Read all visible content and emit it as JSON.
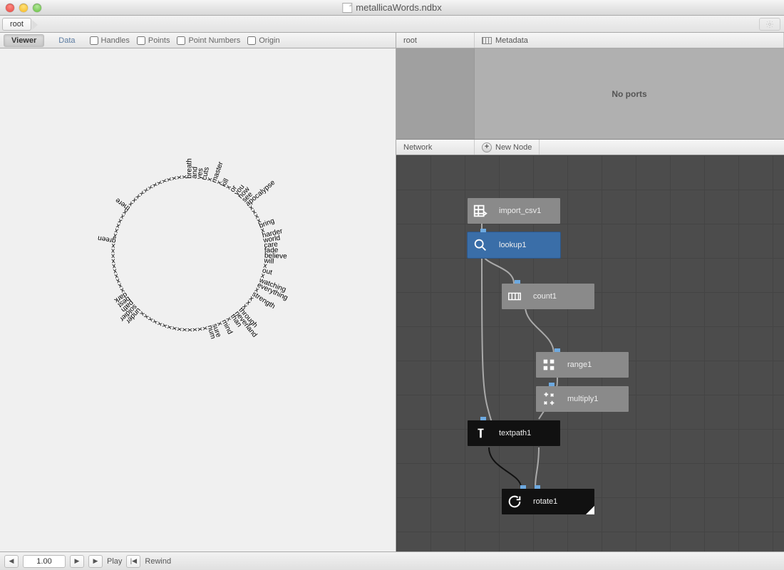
{
  "window": {
    "title": "metallicaWords.ndbx",
    "breadcrumb": "root"
  },
  "left": {
    "tabs": {
      "viewer": "Viewer",
      "data": "Data"
    },
    "checks": {
      "handles": "Handles",
      "points": "Points",
      "pointnums": "Point Numbers",
      "origin": "Origin"
    }
  },
  "props": {
    "root_label": "root",
    "metadata_label": "Metadata",
    "noports": "No ports"
  },
  "network": {
    "header": "Network",
    "newnode": "New Node",
    "nodes": {
      "import": "import_csv1",
      "lookup": "lookup1",
      "count": "count1",
      "range": "range1",
      "multiply": "multiply1",
      "textpath": "textpath1",
      "rotate": "rotate1"
    }
  },
  "footer": {
    "frame": "1.00",
    "play": "Play",
    "rewind": "Rewind"
  },
  "words": [
    "breath",
    "and",
    "yes",
    "cuts",
    "x",
    "master",
    "x",
    "kill",
    "x",
    "or",
    "you",
    "now",
    "see",
    "apocalypse",
    "x",
    "x",
    "x",
    "x",
    "bring",
    "x",
    "harder",
    "world",
    "care",
    "fade",
    "believe",
    "will",
    "x",
    "out",
    "x",
    "watching",
    "everything",
    "x",
    "strength",
    "x",
    "x",
    "x",
    "through",
    "neverland",
    "than",
    "x",
    "mind",
    "x",
    "sure",
    "num",
    "x",
    "x",
    "x",
    "x",
    "x",
    "x",
    "x",
    "x",
    "x",
    "x",
    "x",
    "x",
    "x",
    "x",
    "under",
    "soldier",
    "path",
    "best",
    "dark",
    "x",
    "x",
    "x",
    "x",
    "x",
    "x",
    "x",
    "x",
    "x",
    "x",
    "green",
    "x",
    "x",
    "x",
    "x",
    "x",
    "x",
    "there",
    "x",
    "x",
    "x",
    "x",
    "x",
    "x",
    "x",
    "x",
    "x",
    "x",
    "x",
    "x",
    "x"
  ]
}
